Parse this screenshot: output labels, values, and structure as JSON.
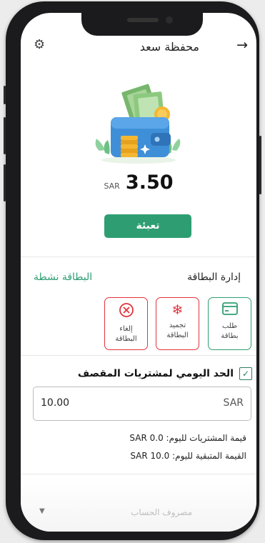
{
  "header": {
    "title": "محفظة سعد",
    "back_icon": "arrow-right-icon",
    "settings_icon": "gear-icon"
  },
  "balance": {
    "amount": "3.50",
    "currency": "SAR"
  },
  "topup_label": "تعبئة",
  "card_management": {
    "title": "إدارة البطاقة",
    "status": "البطاقة نشطة",
    "actions": [
      {
        "line1": "طلب",
        "line2": "بطاقة",
        "icon": "credit-card-icon"
      },
      {
        "line1": "تجميد",
        "line2": "البطاقة",
        "icon": "snowflake-icon"
      },
      {
        "line1": "إلغاء",
        "line2": "البطاقة",
        "icon": "cancel-circle-icon"
      }
    ]
  },
  "daily_limit": {
    "checked": true,
    "label": "الحد اليومي لمشتريات المقصف",
    "value": "10.00",
    "unit": "SAR",
    "today_purchases_label": "قيمة المشتريات لليوم:",
    "today_purchases_value": "SAR 0.0",
    "remaining_label": "القيمة المتبقية لليوم:",
    "remaining_value": "SAR 10.0"
  },
  "account_partial": "مصروف الحساب"
}
